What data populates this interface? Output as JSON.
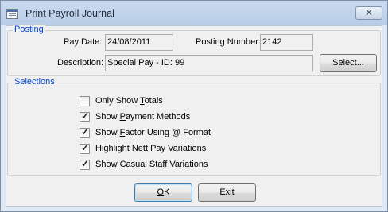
{
  "window": {
    "title": "Print Payroll Journal",
    "close_glyph": "✕"
  },
  "posting": {
    "group_label": "Posting",
    "pay_date_label": "Pay Date:",
    "pay_date_value": "24/08/2011",
    "posting_number_label": "Posting Number:",
    "posting_number_value": "2142",
    "description_label": "Description:",
    "description_value": "Special Pay - ID: 99",
    "select_button": "Select..."
  },
  "selections": {
    "group_label": "Selections",
    "options": [
      {
        "label_pre": "Only Show ",
        "accel": "T",
        "label_post": "otals",
        "checked": false
      },
      {
        "label_pre": "Show ",
        "accel": "P",
        "label_post": "ayment Methods",
        "checked": true
      },
      {
        "label_pre": "Show ",
        "accel": "F",
        "label_post": "actor Using @ Format",
        "checked": true
      },
      {
        "label_pre": "Highlight Nett Pay Variations",
        "accel": "",
        "label_post": "",
        "checked": true
      },
      {
        "label_pre": "Show Casual Staff Variations",
        "accel": "",
        "label_post": "",
        "checked": true
      }
    ]
  },
  "buttons": {
    "ok_accel": "O",
    "ok_rest": "K",
    "exit": "Exit"
  },
  "icons": {
    "app": "window-app-icon",
    "close": "close-icon",
    "checkmark": "checkmark-icon"
  },
  "colors": {
    "group_label": "#0046d5",
    "title_bar": "#c9dbef"
  }
}
